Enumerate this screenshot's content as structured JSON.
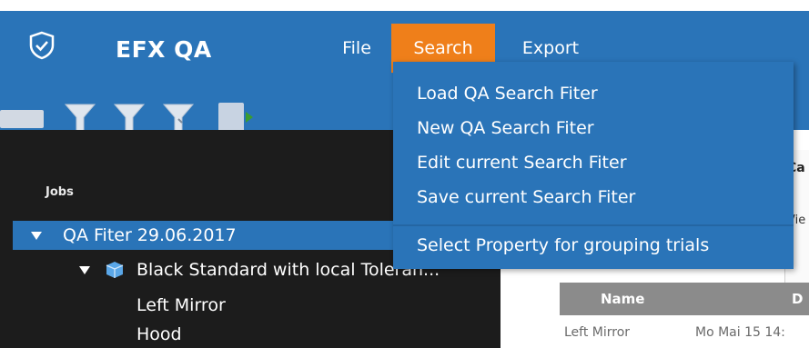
{
  "app": {
    "title": "EFX QA",
    "brand_color": "#2a74b8",
    "accent_color": "#ef7f1a"
  },
  "menu": {
    "file": "File",
    "search": "Search",
    "export": "Export"
  },
  "search_menu": {
    "items": [
      "Load QA Search Fiter",
      "New QA Search Fiter",
      "Edit current Search Fiter",
      "Save current Search Fiter",
      "Select Property for grouping trials"
    ]
  },
  "toolbar": {
    "icons": [
      "folder-icon",
      "filter-icon",
      "filter-add-icon",
      "filter-edit-icon",
      "document-icon",
      "run-icon"
    ]
  },
  "tree": {
    "section_label": "Jobs",
    "root": "QA Fiter 29.06.2017",
    "child": "Black Standard with local Toleran...",
    "leaves": [
      "Left Mirror",
      "Hood"
    ]
  },
  "dialog": {
    "partial_label_1": "Ca",
    "partial_label_2": "Vie"
  },
  "grid": {
    "columns": [
      "Name",
      "D"
    ],
    "rows": [
      {
        "name": "Left Mirror",
        "date": "Mo Mai 15 14:"
      }
    ]
  }
}
